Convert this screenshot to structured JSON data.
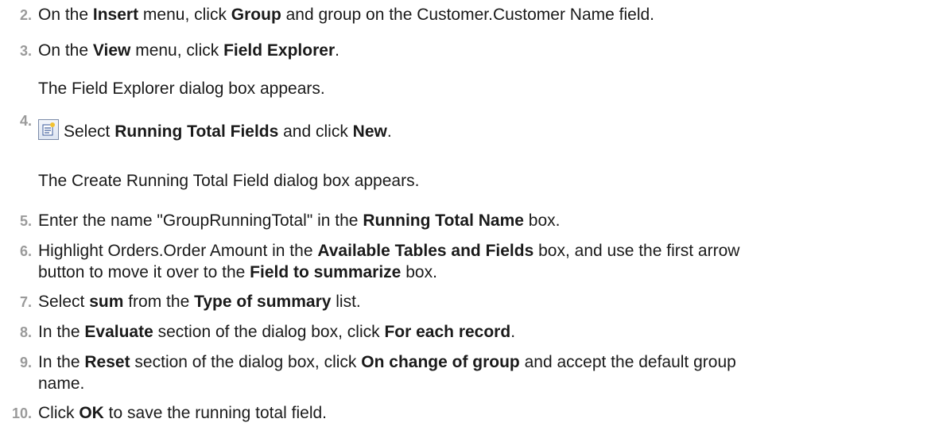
{
  "steps": [
    {
      "num": "2.",
      "parts": [
        "On the ",
        "Insert",
        " menu, click ",
        "Group",
        " and group on the Customer.Customer Name field."
      ]
    },
    {
      "num": "3.",
      "parts": [
        "On the ",
        "View",
        " menu, click ",
        "Field Explorer",
        "."
      ]
    },
    {
      "note1": "The Field Explorer dialog box appears."
    },
    {
      "num": "4.",
      "parts": [
        "Select ",
        "Running Total Fields",
        " and click ",
        "New",
        "."
      ],
      "icon": "new-field-icon"
    },
    {
      "note2": "The Create Running Total Field dialog box appears."
    },
    {
      "num": "5.",
      "parts": [
        "Enter the name \"GroupRunningTotal\" in the ",
        "Running Total Name",
        " box."
      ]
    },
    {
      "num": "6.",
      "line1": [
        "Highlight Orders.Order Amount in the ",
        "Available Tables and Fields",
        " box, and use the first arrow"
      ],
      "line2": [
        "button to move it over to the ",
        "Field to summarize",
        " box."
      ]
    },
    {
      "num": "7.",
      "parts": [
        "Select ",
        "sum",
        " from the ",
        "Type of summary",
        " list."
      ]
    },
    {
      "num": "8.",
      "parts": [
        "In the ",
        "Evaluate",
        " section of the dialog box, click ",
        "For each record",
        "."
      ]
    },
    {
      "num": "9.",
      "line1": [
        "In the ",
        "Reset",
        " section of the dialog box, click ",
        "On change of group",
        " and accept the default group"
      ],
      "line2": [
        "name."
      ]
    },
    {
      "num": "10.",
      "parts": [
        "Click ",
        "OK",
        " to save the running total field."
      ]
    }
  ],
  "colors": {
    "number": "#9a9a9a",
    "text": "#1a1a1a"
  }
}
